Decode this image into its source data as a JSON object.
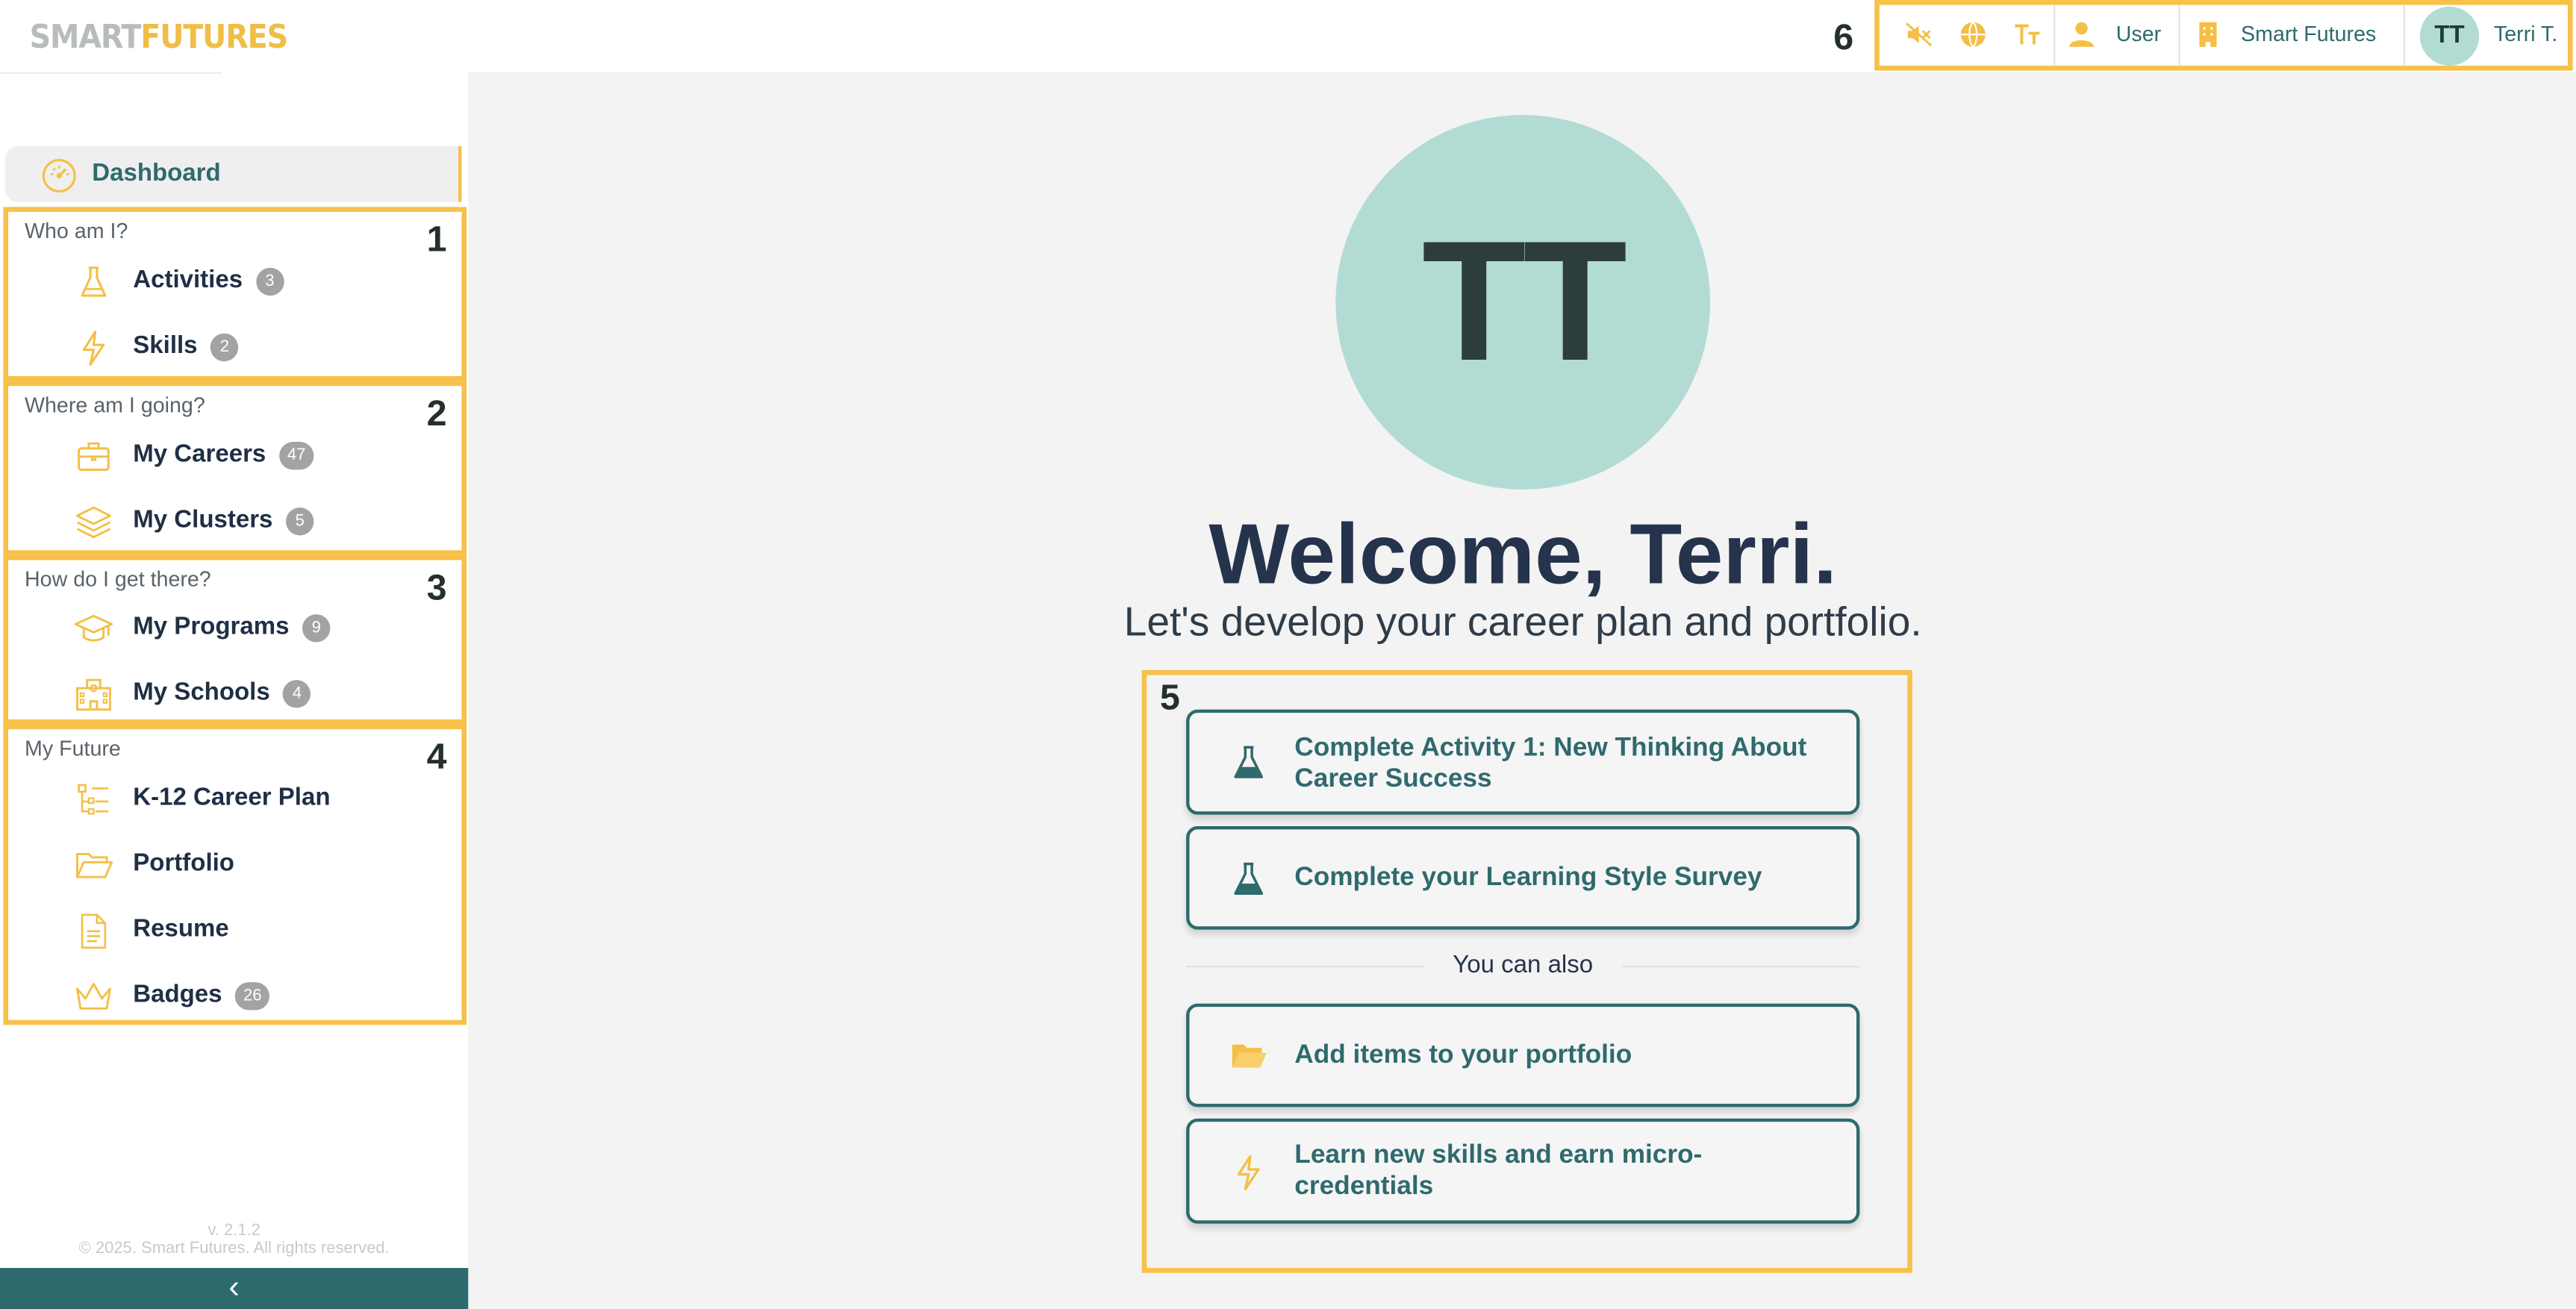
{
  "brand": {
    "logo_part1": "SMART",
    "logo_part2": "FUTURES"
  },
  "sidebar": {
    "dashboard_label": "Dashboard",
    "groups": [
      {
        "title": "Who am I?",
        "number": "1",
        "items": [
          {
            "label": "Activities",
            "count": "3",
            "icon": "flask-icon"
          },
          {
            "label": "Skills",
            "count": "2",
            "icon": "bolt-icon"
          }
        ]
      },
      {
        "title": "Where am I going?",
        "number": "2",
        "items": [
          {
            "label": "My Careers",
            "count": "47",
            "icon": "briefcase-icon"
          },
          {
            "label": "My Clusters",
            "count": "5",
            "icon": "layers-icon"
          }
        ]
      },
      {
        "title": "How do I get there?",
        "number": "3",
        "items": [
          {
            "label": "My Programs",
            "count": "9",
            "icon": "graduation-cap-icon"
          },
          {
            "label": "My Schools",
            "count": "4",
            "icon": "school-icon"
          }
        ]
      },
      {
        "title": "My Future",
        "number": "4",
        "items": [
          {
            "label": "K-12 Career Plan",
            "icon": "tree-list-icon"
          },
          {
            "label": "Portfolio",
            "icon": "folder-open-icon"
          },
          {
            "label": "Resume",
            "icon": "document-icon"
          },
          {
            "label": "Badges",
            "count": "26",
            "icon": "crown-icon"
          }
        ]
      }
    ],
    "version": "v. 2.1.2",
    "copyright": "© 2025. Smart Futures. All rights reserved.",
    "collapse_glyph": "‹"
  },
  "topbar": {
    "number": "6",
    "role_label": "User",
    "org_label": "Smart Futures",
    "avatar_initials": "TT",
    "user_name": "Terri T."
  },
  "main": {
    "avatar_initials": "TT",
    "welcome": "Welcome, Terri.",
    "subtitle": "Let's develop your career plan and portfolio.",
    "panel_number": "5",
    "todo": [
      {
        "line1": "Complete Activity 1: New Thinking About",
        "line2": "Career Success",
        "icon": "flask-icon"
      },
      {
        "line1": "Complete your Learning Style Survey",
        "line2": "",
        "icon": "flask-icon"
      }
    ],
    "also_label": "You can also",
    "also": [
      {
        "line1": "Add items to your portfolio",
        "line2": "",
        "icon": "folder-open-icon"
      },
      {
        "line1": "Learn new skills and earn micro-",
        "line2": "credentials",
        "icon": "bolt-icon"
      }
    ]
  },
  "colors": {
    "accent": "#f4bf44",
    "teal": "#2f6a6d",
    "avatar": "#b2dcd3",
    "navy": "#25334c"
  }
}
